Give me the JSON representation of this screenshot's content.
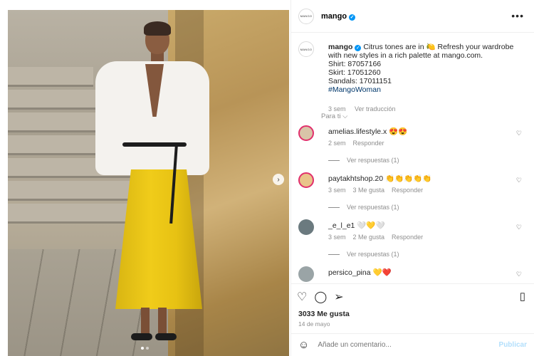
{
  "post": {
    "account": "mango",
    "avatar_text": "MANGO",
    "caption_prefix": "Citrus tones are in",
    "caption_rest": "Refresh your wardrobe with new styles in a rich palette at mango.com.",
    "shirt": "Shirt: 87057166",
    "skirt": "Skirt: 17051260",
    "sandals": "Sandals: 17011151",
    "hashtag": "#MangoWoman",
    "time": "3 sem",
    "translation": "Ver traducción",
    "for_you": "Para ti",
    "likes": "3033 Me gusta",
    "date": "14 de mayo"
  },
  "comments": [
    {
      "user": "amelias.lifestyle.x",
      "text": "😍😍",
      "time": "2 sem",
      "likes": "",
      "reply": "Responder",
      "view_replies": "Ver respuestas (1)",
      "avatar_color": "#d9c4a8"
    },
    {
      "user": "paytakhtshop.20",
      "text": "👏👏👏👏👏",
      "time": "3 sem",
      "likes": "3 Me gusta",
      "reply": "Responder",
      "view_replies": "Ver respuestas (1)",
      "avatar_color": "#e9c48a"
    },
    {
      "user": "_e_l_e1",
      "text": "🤍💛🤍",
      "time": "3 sem",
      "likes": "2 Me gusta",
      "reply": "Responder",
      "view_replies": "Ver respuestas (1)",
      "avatar_color": "#6b7a7f"
    },
    {
      "user": "persico_pina",
      "text": "💛❤️",
      "time": "",
      "likes": "",
      "reply": "",
      "view_replies": "",
      "avatar_color": "#9aa4a6"
    }
  ],
  "input": {
    "placeholder": "Añade un comentario...",
    "publish": "Publicar"
  },
  "icons": {
    "more": "more-options-icon",
    "heart": "heart-icon",
    "comment": "comment-icon",
    "share": "share-icon",
    "bookmark": "bookmark-icon",
    "emoji": "emoji-icon",
    "next": "chevron-right-icon"
  }
}
